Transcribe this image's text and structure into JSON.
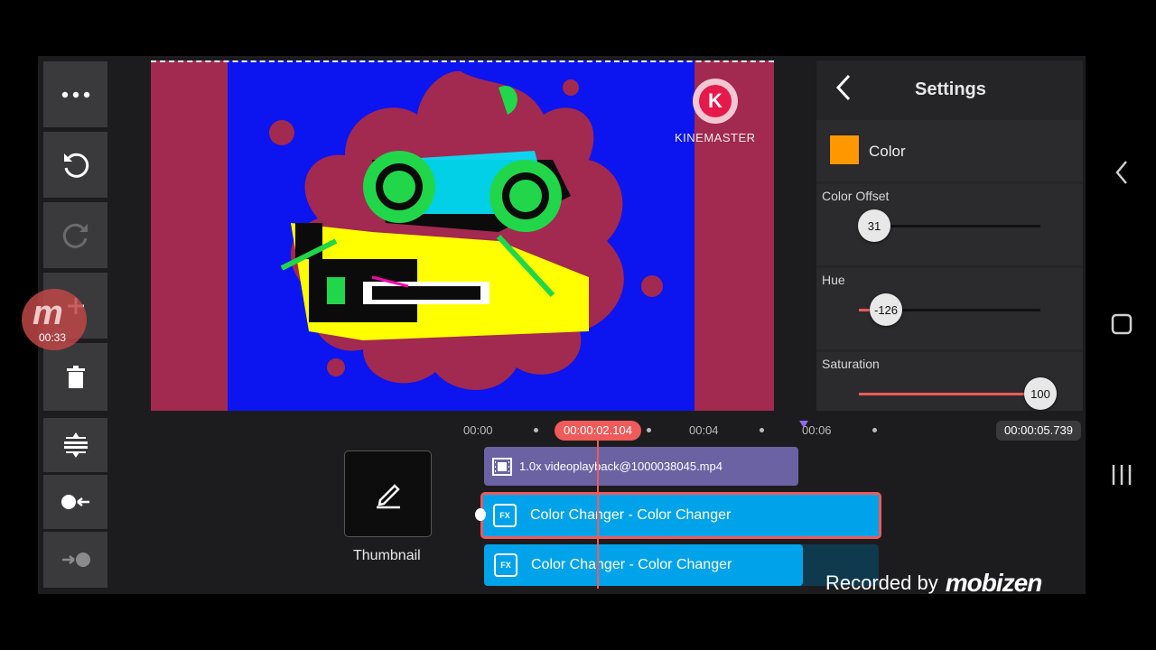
{
  "preview": {
    "watermark_letter": "K",
    "watermark_text": "KINEMASTER"
  },
  "settings": {
    "title": "Settings",
    "color_label": "Color",
    "color_swatch": "#ff9800",
    "color_offset": {
      "label": "Color Offset",
      "value": "31"
    },
    "hue": {
      "label": "Hue",
      "value": "-126"
    },
    "saturation": {
      "label": "Saturation",
      "value": "100"
    }
  },
  "toolbar": {
    "items": [
      "more-icon",
      "undo-icon",
      "redo-icon",
      "add-layer-icon",
      "delete-icon",
      "split-icon",
      "set-start-icon",
      "set-end-icon"
    ]
  },
  "recorder_badge": {
    "time": "00:33",
    "logo": "m"
  },
  "timeline": {
    "ruler": [
      "00:00",
      "00:04",
      "00:06"
    ],
    "playhead_time": "00:00:02.104",
    "total_time": "00:00:05.739",
    "thumbnail_label": "Thumbnail",
    "video_clip": "1.0x videoplayback@1000038045.mp4",
    "effect_clips": [
      "Color Changer - Color Changer",
      "Color Changer - Color Changer"
    ],
    "fx_badge": "FX"
  },
  "recorded_by": {
    "text": "Recorded by",
    "brand": "mobizen"
  },
  "colors": {
    "accent_red": "#ef5a5a",
    "video_clip_bg": "#6b62a3",
    "effect_clip_bg": "#00a3ea",
    "preview_bg": "#a2294f",
    "preview_blue": "#0c14f0"
  }
}
